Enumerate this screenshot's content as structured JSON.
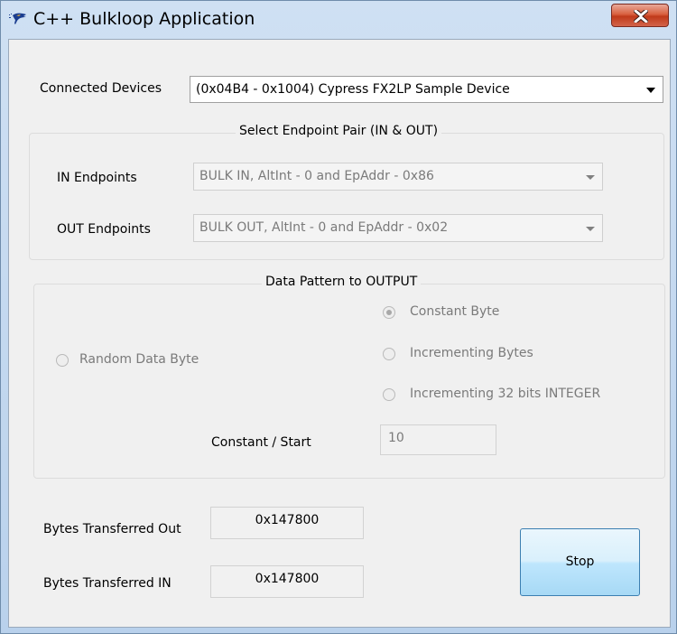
{
  "window": {
    "title": "C++ Bulkloop Application",
    "app_icon": "cypress-logo-icon",
    "close_icon": "close-icon",
    "close_color": "#c8442a"
  },
  "devices": {
    "label": "Connected Devices",
    "selected": "(0x04B4 - 0x1004) Cypress FX2LP Sample Device"
  },
  "endpoints": {
    "group_title": "Select Endpoint Pair (IN & OUT)",
    "in_label": "IN Endpoints",
    "in_selected": "BULK IN, AltInt - 0 and EpAddr - 0x86",
    "out_label": "OUT Endpoints",
    "out_selected": "BULK OUT, AltInt - 0 and EpAddr - 0x02"
  },
  "pattern": {
    "group_title": "Data Pattern to OUTPUT",
    "random_label": "Random Data Byte",
    "constant_label": "Constant Byte",
    "incrementing_label": "Incrementing Bytes",
    "int32_label": "Incrementing 32 bits INTEGER",
    "selected": "Constant Byte",
    "start_label": "Constant / Start",
    "start_value": "10"
  },
  "stats": {
    "out_label": "Bytes Transferred Out",
    "out_value": "0x147800",
    "in_label": "Bytes Transferred IN",
    "in_value": "0x147800"
  },
  "actions": {
    "stop_label": "Stop"
  }
}
